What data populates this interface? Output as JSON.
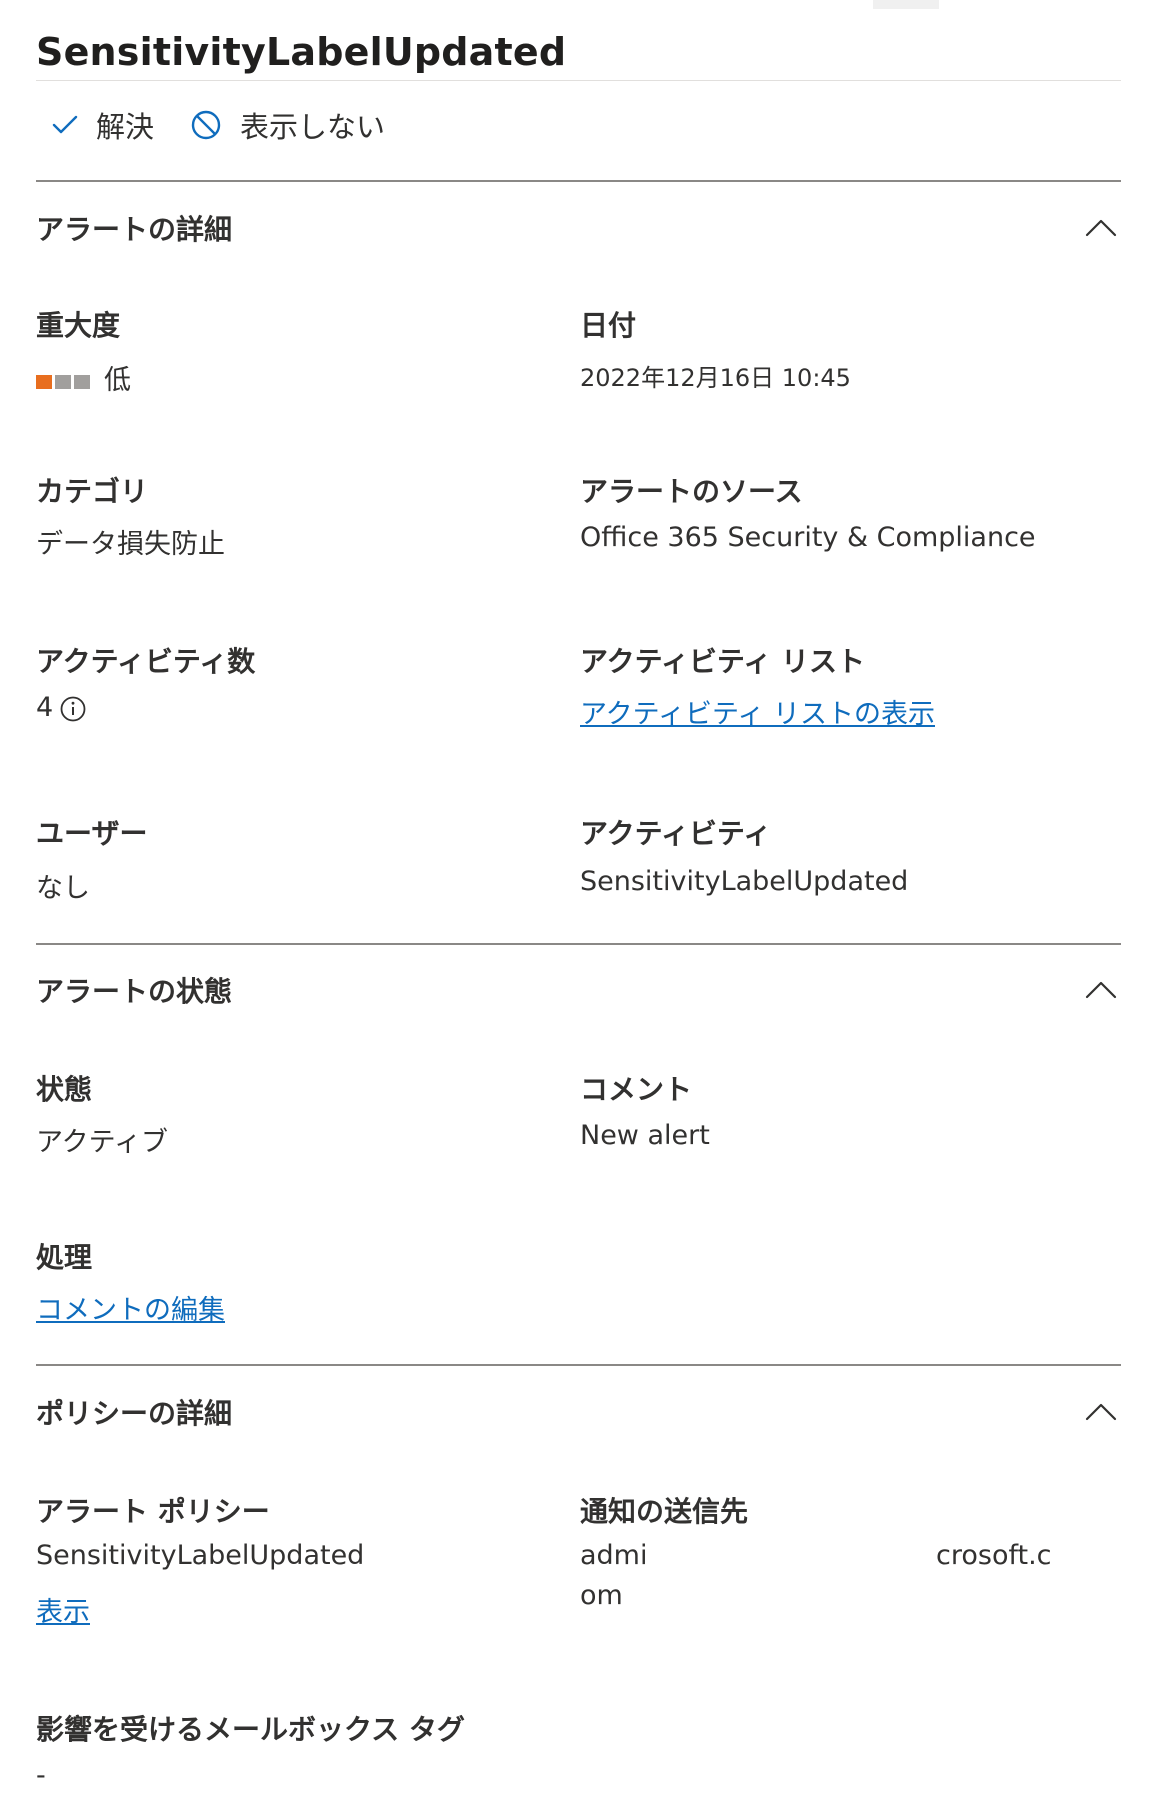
{
  "title": "SensitivityLabelUpdated",
  "actions": {
    "resolve": {
      "label": "解決",
      "icon": "checkmark-icon"
    },
    "suppress": {
      "label": "表示しない",
      "icon": "block-icon"
    }
  },
  "alert_details": {
    "header": "アラートの詳細",
    "severity": {
      "label": "重大度",
      "value": "低",
      "level": 1,
      "max_level": 3,
      "color_on": "#e86e1f",
      "color_off": "#a19f9d"
    },
    "date": {
      "label": "日付",
      "value": "2022年12月16日 10:45"
    },
    "category": {
      "label": "カテゴリ",
      "value": "データ損失防止"
    },
    "source": {
      "label": "アラートのソース",
      "value": "Office 365 Security & Compliance"
    },
    "activity_count": {
      "label": "アクティビティ数",
      "value": "4"
    },
    "activity_list": {
      "label": "アクティビティ リスト",
      "link": "アクティビティ リストの表示"
    },
    "user": {
      "label": "ユーザー",
      "value": "なし"
    },
    "activity": {
      "label": "アクティビティ",
      "value": "SensitivityLabelUpdated"
    }
  },
  "alert_status": {
    "header": "アラートの状態",
    "status": {
      "label": "状態",
      "value": "アクティブ"
    },
    "comment": {
      "label": "コメント",
      "value": "New alert"
    },
    "action": {
      "label": "処理",
      "link": "コメントの編集"
    }
  },
  "policy_details": {
    "header": "ポリシーの詳細",
    "alert_policy": {
      "label": "アラート ポリシー",
      "value": "SensitivityLabelUpdated",
      "link": "表示"
    },
    "notify": {
      "label": "通知の送信先",
      "value_start": "admi",
      "value_end": "crosoft.c",
      "value_wrap": "om"
    },
    "mailbox_tags": {
      "label": "影響を受けるメールボックス タグ",
      "value": "-"
    }
  },
  "colors": {
    "link": "#0f6cbd",
    "rule": "#8a8886",
    "accent_icon": "#0f6cbd"
  }
}
